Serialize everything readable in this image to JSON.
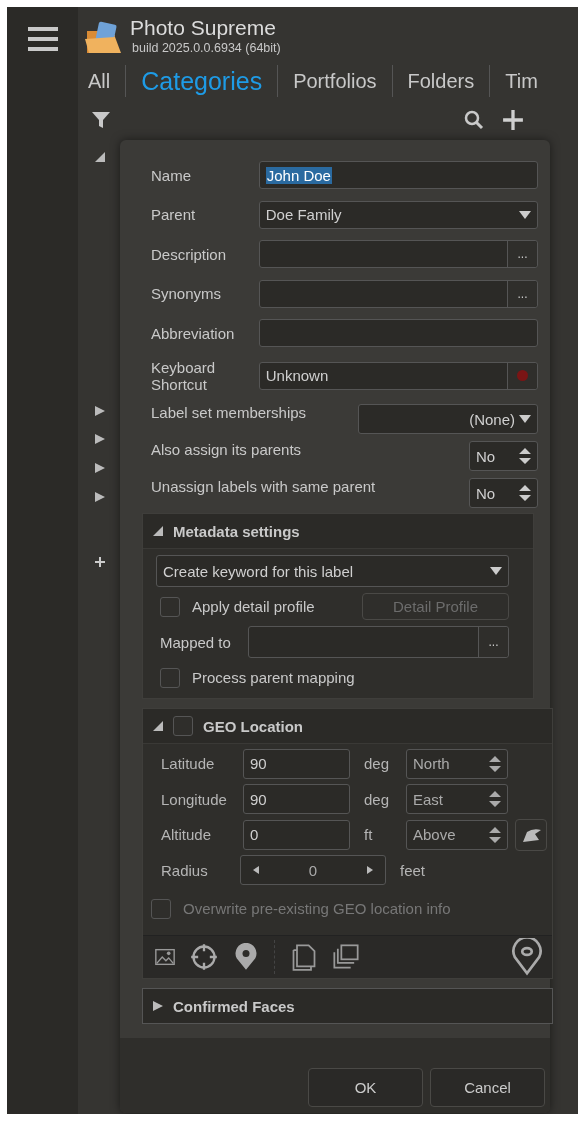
{
  "app": {
    "title": "Photo Supreme",
    "build": "build 2025.0.0.6934 (64bit)"
  },
  "tabs": [
    {
      "label": "All",
      "selected": false
    },
    {
      "label": "Categories",
      "selected": true
    },
    {
      "label": "Portfolios",
      "selected": false
    },
    {
      "label": "Folders",
      "selected": false
    },
    {
      "label": "Tim",
      "selected": false
    }
  ],
  "dialog": {
    "fields": [
      {
        "label": "Name",
        "kind": "text",
        "value": "John Doe",
        "text_selected": true
      },
      {
        "label": "Parent",
        "kind": "select",
        "value": "Doe Family"
      },
      {
        "label": "Description",
        "kind": "browse",
        "button": "..."
      },
      {
        "label": "Synonyms",
        "kind": "browse",
        "button": "..."
      },
      {
        "label": "Abbreviation",
        "kind": "text"
      },
      {
        "label": "Keyboard Shortcut",
        "kind": "shortcut",
        "value": "Unknown"
      }
    ],
    "label_sets": {
      "label": "Label set memberships",
      "value": "(None)"
    },
    "options": [
      {
        "label": "Also assign its parents",
        "value": "No"
      },
      {
        "label": "Unassign labels with same parent",
        "value": "No"
      }
    ],
    "metadata": {
      "title": "Metadata settings",
      "expanded": true,
      "mode": "Create keyword for this label",
      "apply_detail_profile": {
        "label": "Apply detail profile",
        "checked": false
      },
      "detail_profile_button": {
        "label": "Detail Profile",
        "disabled": true
      },
      "mapped_to": {
        "label": "Mapped to",
        "button": "..."
      },
      "process_parent_mapping": {
        "label": "Process parent mapping",
        "checked": false
      }
    },
    "geo": {
      "title": "GEO Location",
      "expanded": true,
      "checked": false,
      "rows": [
        {
          "label": "Latitude",
          "value": "90",
          "unit": "deg",
          "direction": "North"
        },
        {
          "label": "Longitude",
          "value": "90",
          "unit": "deg",
          "direction": "East"
        },
        {
          "label": "Altitude",
          "value": "0",
          "unit": "ft",
          "direction": "Above"
        }
      ],
      "radius": {
        "label": "Radius",
        "value": "0",
        "unit": "feet"
      },
      "overwrite": {
        "label": "Overwrite pre-existing GEO location info",
        "checked": false,
        "disabled": true
      }
    },
    "faces": {
      "title": "Confirmed Faces",
      "expanded": false
    },
    "buttons": [
      "OK",
      "Cancel"
    ]
  }
}
